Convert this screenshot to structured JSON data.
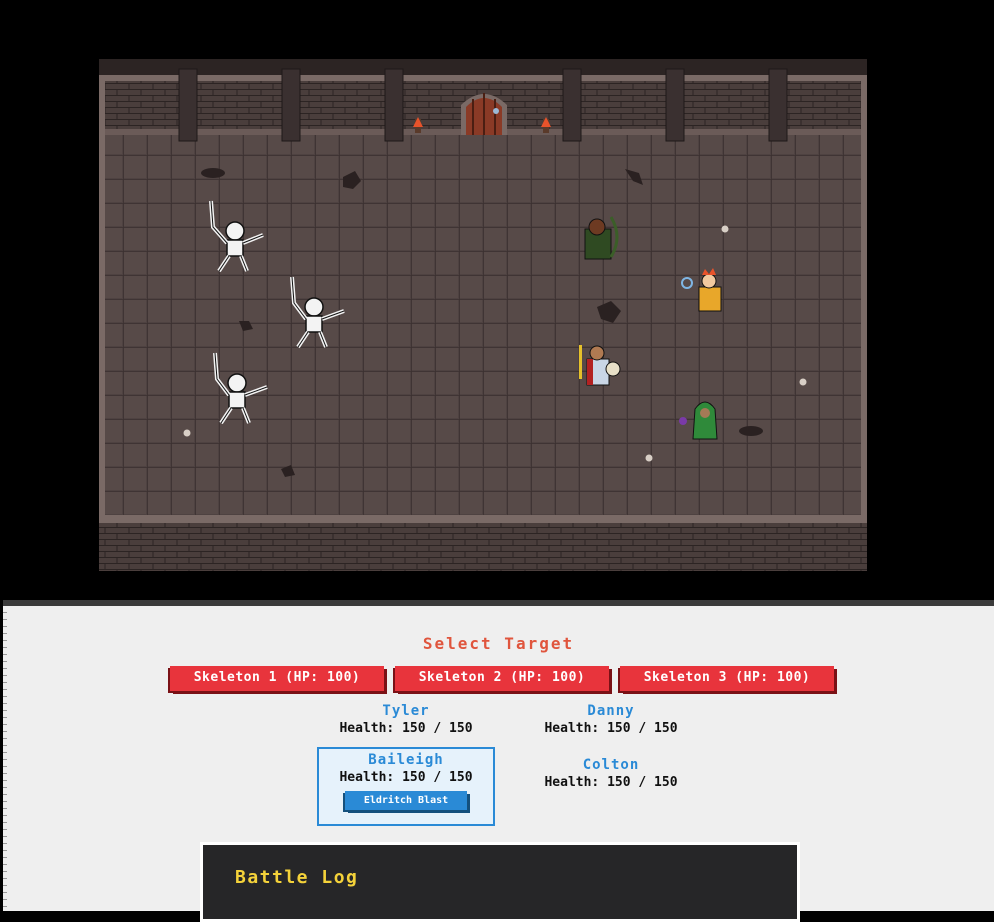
{
  "scene": {
    "enemies": [
      {
        "name": "skeleton-1"
      },
      {
        "name": "skeleton-2"
      },
      {
        "name": "skeleton-3"
      }
    ],
    "heroes": [
      {
        "name": "ranger"
      },
      {
        "name": "fire-mage"
      },
      {
        "name": "knight"
      },
      {
        "name": "warlock"
      }
    ],
    "colors": {
      "floor": "#4e4241",
      "wall": "#3b3030",
      "skeleton": "#f3f3f3"
    }
  },
  "target_select": {
    "title": "Select Target",
    "targets": [
      {
        "label": "Skeleton 1 (HP: 100)"
      },
      {
        "label": "Skeleton 2 (HP: 100)"
      },
      {
        "label": "Skeleton 3 (HP: 100)"
      }
    ]
  },
  "party": [
    {
      "name": "Tyler",
      "health": "Health: 150 / 150"
    },
    {
      "name": "Danny",
      "health": "Health: 150 / 150"
    },
    {
      "name": "Baileigh",
      "health": "Health: 150 / 150",
      "ability": "Eldritch Blast"
    },
    {
      "name": "Colton",
      "health": "Health: 150 / 150"
    }
  ],
  "battle_log": {
    "title": "Battle Log"
  },
  "colors": {
    "accent_red": "#e8343c",
    "accent_blue": "#2a8ad6",
    "log_title": "#f4d23a"
  }
}
